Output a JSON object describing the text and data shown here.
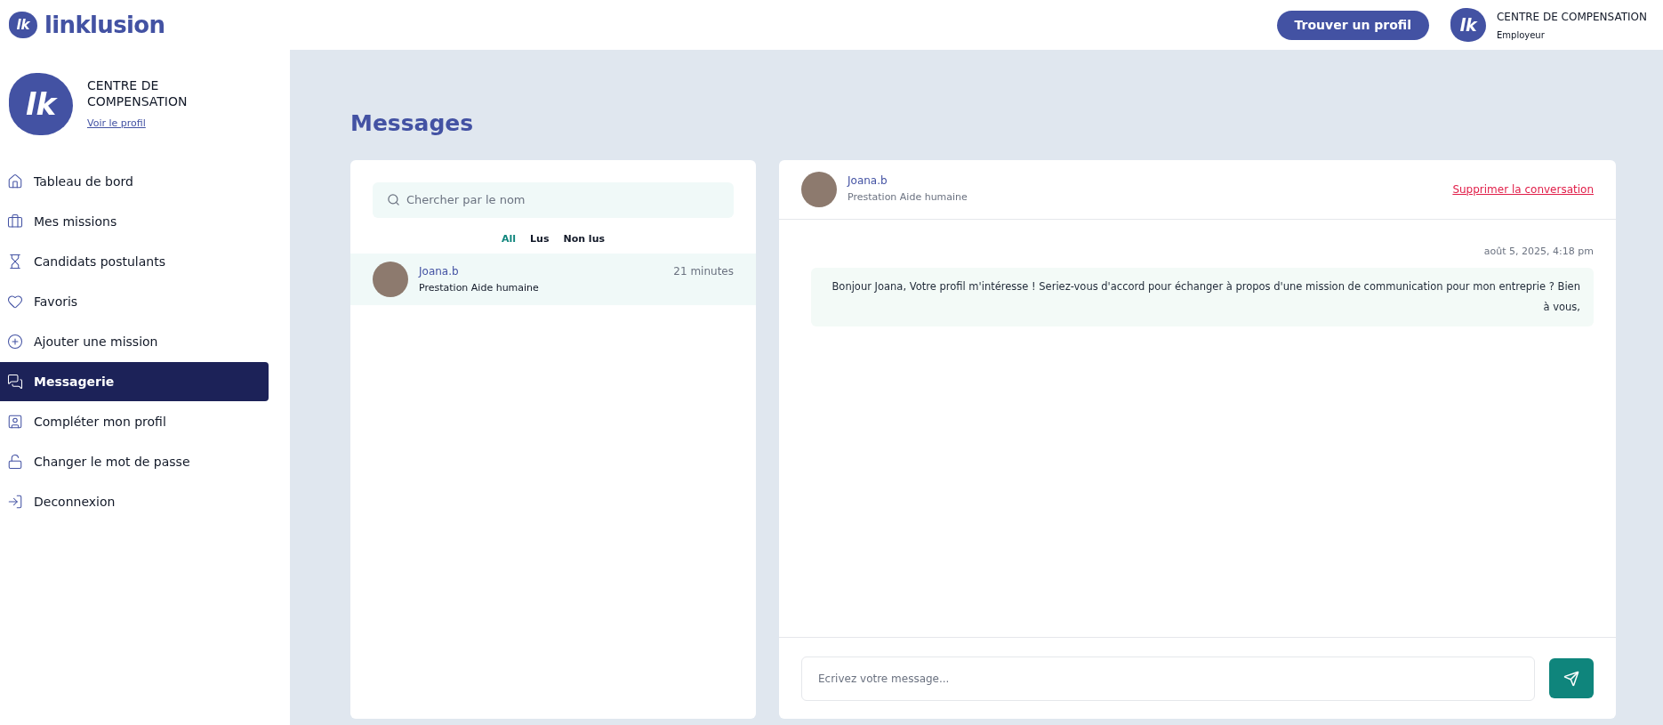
{
  "header": {
    "logo_mark": "lk",
    "brand": "linklusion",
    "find_button": "Trouver un profil",
    "account": {
      "logo_mark": "lk",
      "name": "CENTRE DE COMPENSATION",
      "role": "Employeur"
    }
  },
  "sidebar": {
    "profile": {
      "logo_mark": "lk",
      "name": "CENTRE DE COMPENSATION",
      "link": "Voir le profil"
    },
    "items": [
      {
        "label": "Tableau de bord",
        "selected": false
      },
      {
        "label": "Mes missions",
        "selected": false
      },
      {
        "label": "Candidats postulants",
        "selected": false
      },
      {
        "label": "Favoris",
        "selected": false
      },
      {
        "label": "Ajouter une mission",
        "selected": false
      },
      {
        "label": "Messagerie",
        "selected": true
      },
      {
        "label": "Compléter mon profil",
        "selected": false
      },
      {
        "label": "Changer le mot de passe",
        "selected": false
      },
      {
        "label": "Deconnexion",
        "selected": false
      }
    ]
  },
  "page_title": "Messages",
  "conversations": {
    "search": {
      "placeholder": "Chercher par le nom"
    },
    "filters": [
      {
        "label": "All",
        "selected": true
      },
      {
        "label": "Lus",
        "selected": false
      },
      {
        "label": "Non lus",
        "selected": false
      }
    ],
    "items": [
      {
        "name": "Joana.b",
        "subtitle": "Prestation Aide humaine",
        "time": "21 minutes",
        "selected": true
      }
    ]
  },
  "chat": {
    "name": "Joana.b",
    "subtitle": "Prestation Aide humaine",
    "delete_link": "Supprimer la conversation",
    "messages": [
      {
        "date": "août 5, 2025, 4:18 pm",
        "text": "Bonjour Joana, Votre profil m'intéresse ! Seriez-vous d'accord pour échanger à propos d'une mission de communication pour mon entreprie ? Bien à vous,"
      }
    ],
    "composer": {
      "placeholder": "Ecrivez votre message..."
    }
  }
}
